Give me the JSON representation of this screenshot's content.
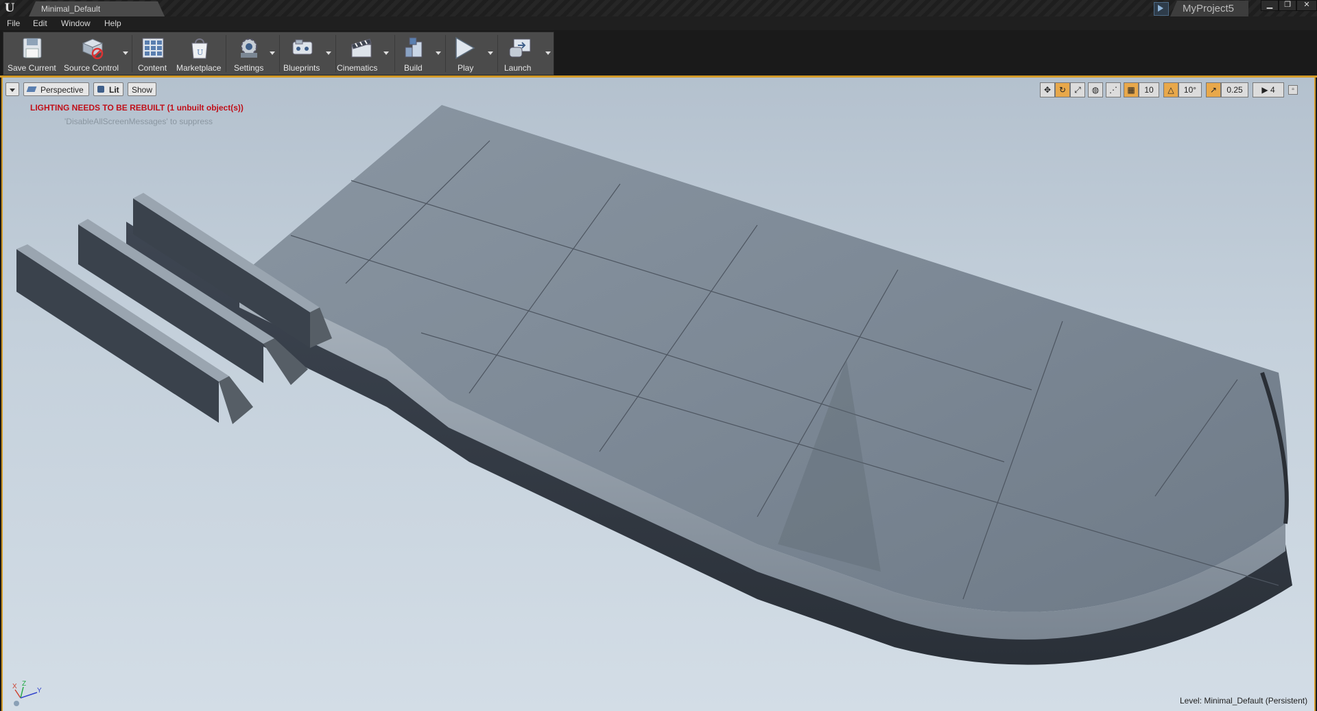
{
  "window": {
    "document_tab": "Minimal_Default",
    "project_name": "MyProject5",
    "controls": [
      "minimize",
      "restore",
      "close"
    ]
  },
  "menu": [
    "File",
    "Edit",
    "Window",
    "Help"
  ],
  "toolbar": [
    {
      "label": "Save Current",
      "icon": "save-icon",
      "dropdown": false
    },
    {
      "label": "Source Control",
      "icon": "source-control-icon",
      "dropdown": true
    },
    {
      "label": "Content",
      "icon": "content-icon",
      "dropdown": false
    },
    {
      "label": "Marketplace",
      "icon": "marketplace-icon",
      "dropdown": false
    },
    {
      "label": "Settings",
      "icon": "settings-icon",
      "dropdown": true
    },
    {
      "label": "Blueprints",
      "icon": "blueprints-icon",
      "dropdown": true
    },
    {
      "label": "Cinematics",
      "icon": "cinematics-icon",
      "dropdown": true
    },
    {
      "label": "Build",
      "icon": "build-icon",
      "dropdown": true
    },
    {
      "label": "Play",
      "icon": "play-icon",
      "dropdown": true
    },
    {
      "label": "Launch",
      "icon": "launch-icon",
      "dropdown": true
    }
  ],
  "viewport": {
    "view_mode": "Perspective",
    "lighting_mode": "Lit",
    "show_label": "Show",
    "warning": "LIGHTING NEEDS TO BE REBUILT (1 unbuilt object(s))",
    "suppress_hint": "'DisableAllScreenMessages' to suppress",
    "grid_snap": "10",
    "rotation_snap": "10°",
    "scale_snap": "0.25",
    "camera_speed": "4",
    "level_label": "Level:",
    "level_name": "Minimal_Default (Persistent)",
    "axis_labels": [
      "X",
      "Z",
      "Y"
    ]
  },
  "colors": {
    "accent": "#d29a28",
    "warning": "#c0101a",
    "viewport_sky": "#c4d0db"
  }
}
